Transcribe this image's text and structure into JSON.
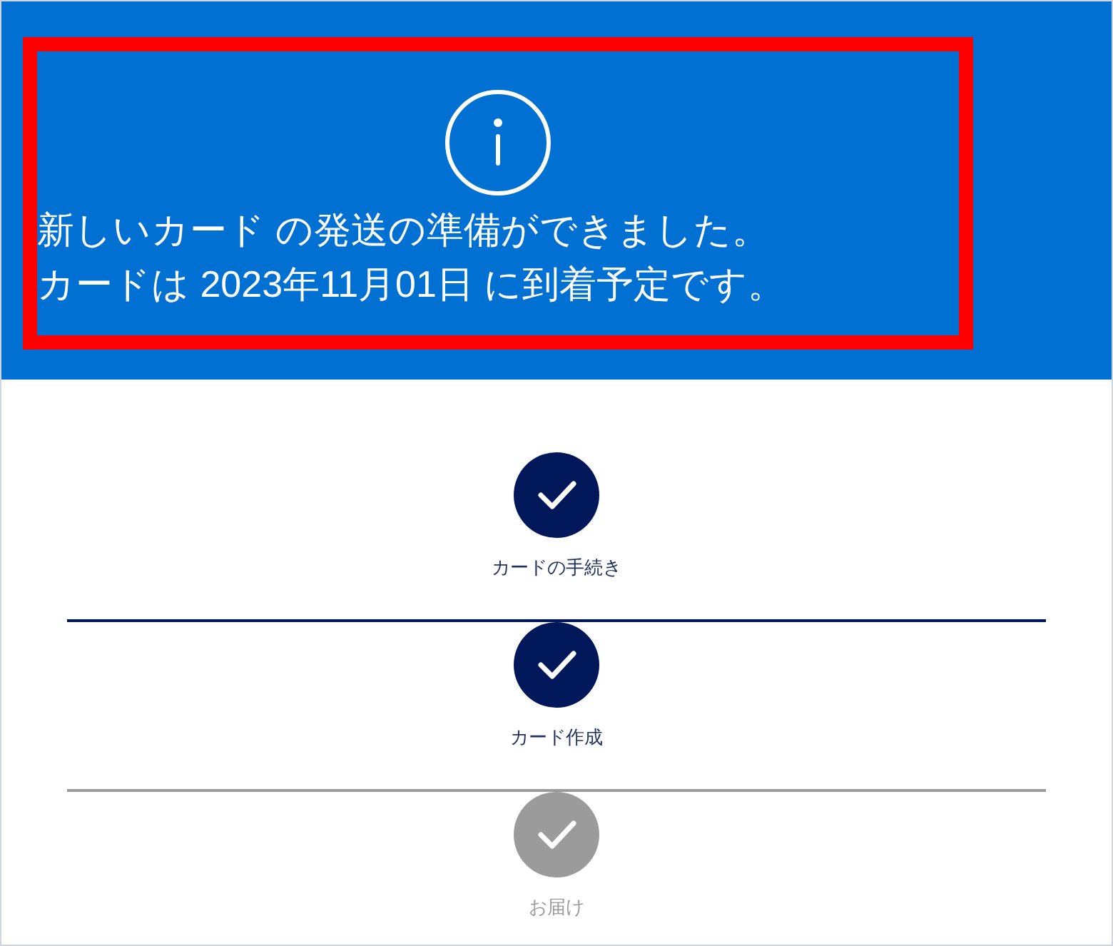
{
  "banner": {
    "lines": [
      "新しいカード の発送の準備ができました。",
      "カードは 2023年11月01日 に到着予定です。"
    ],
    "highlighted": true
  },
  "steps": [
    {
      "label": "カードの手続き",
      "done": true
    },
    {
      "label": "カード作成",
      "done": true
    },
    {
      "label": "お届け",
      "done": false
    }
  ]
}
